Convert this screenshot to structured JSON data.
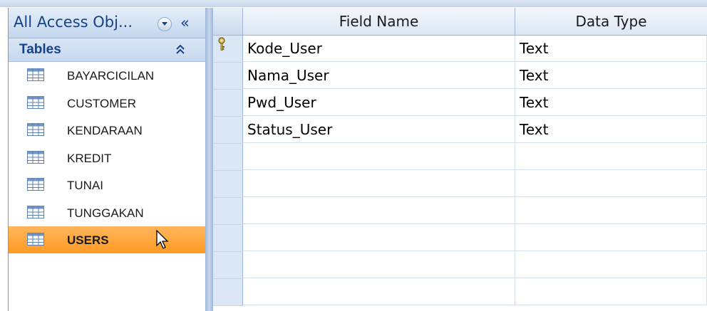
{
  "nav": {
    "title": "All Access Obj...",
    "collapse_glyph": "«",
    "group": {
      "label": "Tables",
      "toggle_icon": "double-chevron-up"
    },
    "items": [
      {
        "label": "BAYARCICILAN",
        "selected": false
      },
      {
        "label": "CUSTOMER",
        "selected": false
      },
      {
        "label": "KENDARAAN",
        "selected": false
      },
      {
        "label": "KREDIT",
        "selected": false
      },
      {
        "label": "TUNAI",
        "selected": false
      },
      {
        "label": "TUNGGAKAN",
        "selected": false
      },
      {
        "label": "USERS",
        "selected": true
      }
    ]
  },
  "grid": {
    "columns": [
      "Field Name",
      "Data Type"
    ],
    "rows": [
      {
        "field": "Kode_User",
        "type": "Text",
        "primary_key": true
      },
      {
        "field": "Nama_User",
        "type": "Text",
        "primary_key": false
      },
      {
        "field": "Pwd_User",
        "type": "Text",
        "primary_key": false
      },
      {
        "field": "Status_User",
        "type": "Text",
        "primary_key": false
      },
      {
        "field": "",
        "type": "",
        "primary_key": false
      },
      {
        "field": "",
        "type": "",
        "primary_key": false
      },
      {
        "field": "",
        "type": "",
        "primary_key": false
      },
      {
        "field": "",
        "type": "",
        "primary_key": false
      },
      {
        "field": "",
        "type": "",
        "primary_key": false
      },
      {
        "field": "",
        "type": "",
        "primary_key": false
      }
    ]
  },
  "colors": {
    "selected": "#ff9a22",
    "header_text": "#15428b"
  }
}
